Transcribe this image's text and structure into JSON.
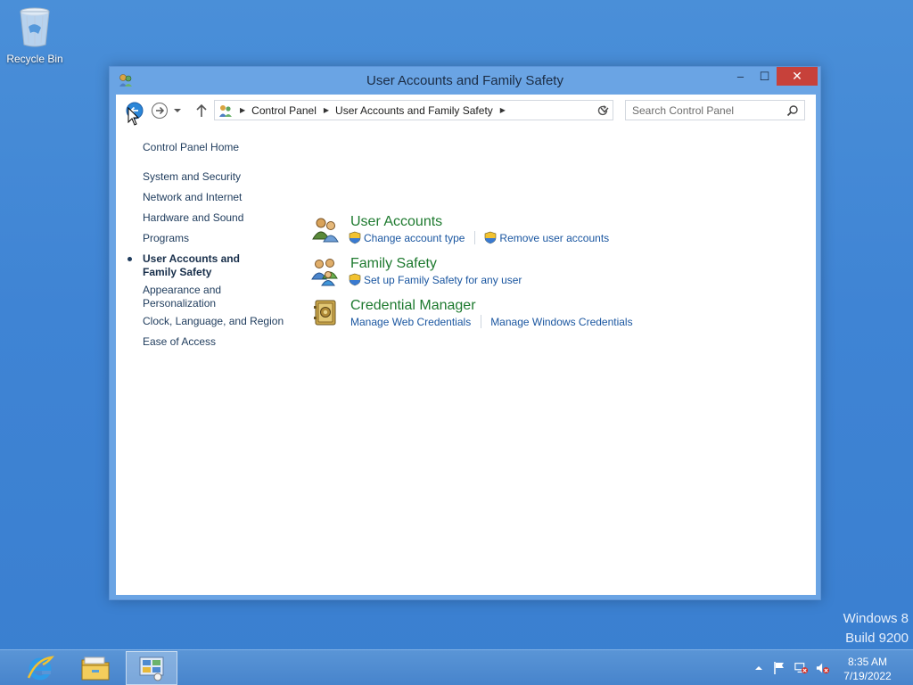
{
  "desktop": {
    "recycle_bin_label": "Recycle Bin",
    "watermark_line1": "Windows 8",
    "watermark_line2": "Build 9200"
  },
  "window": {
    "title": "User Accounts and Family Safety",
    "controls": {
      "minimize": "–",
      "maximize": "☐",
      "close": "✕"
    }
  },
  "address_bar": {
    "crumbs": [
      "Control Panel",
      "User Accounts and Family Safety"
    ],
    "search_placeholder": "Search Control Panel"
  },
  "left_nav": {
    "home": "Control Panel Home",
    "items": [
      "System and Security",
      "Network and Internet",
      "Hardware and Sound",
      "Programs",
      "User Accounts and Family Safety",
      "Appearance and Personalization",
      "Clock, Language, and Region",
      "Ease of Access"
    ],
    "active_index": 4
  },
  "categories": [
    {
      "title": "User Accounts",
      "icon": "user-accounts-icon",
      "links": [
        "Change account type",
        "Remove user accounts"
      ],
      "shielded": [
        true,
        true
      ]
    },
    {
      "title": "Family Safety",
      "icon": "family-safety-icon",
      "links": [
        "Set up Family Safety for any user"
      ],
      "shielded": [
        true
      ]
    },
    {
      "title": "Credential Manager",
      "icon": "credential-manager-icon",
      "links": [
        "Manage Web Credentials",
        "Manage Windows Credentials"
      ],
      "shielded": [
        false,
        false
      ]
    }
  ],
  "taskbar": {
    "apps": [
      "internet-explorer-icon",
      "file-explorer-icon",
      "control-panel-icon"
    ],
    "active_app": "control-panel-icon",
    "time": "8:35 AM",
    "date": "7/19/2022"
  },
  "colors": {
    "desktop": "#3f84d4",
    "window_frame": "#6aa4e4",
    "category_title": "#1e7a2f",
    "link": "#1a56a0",
    "close_button": "#c7413a"
  }
}
